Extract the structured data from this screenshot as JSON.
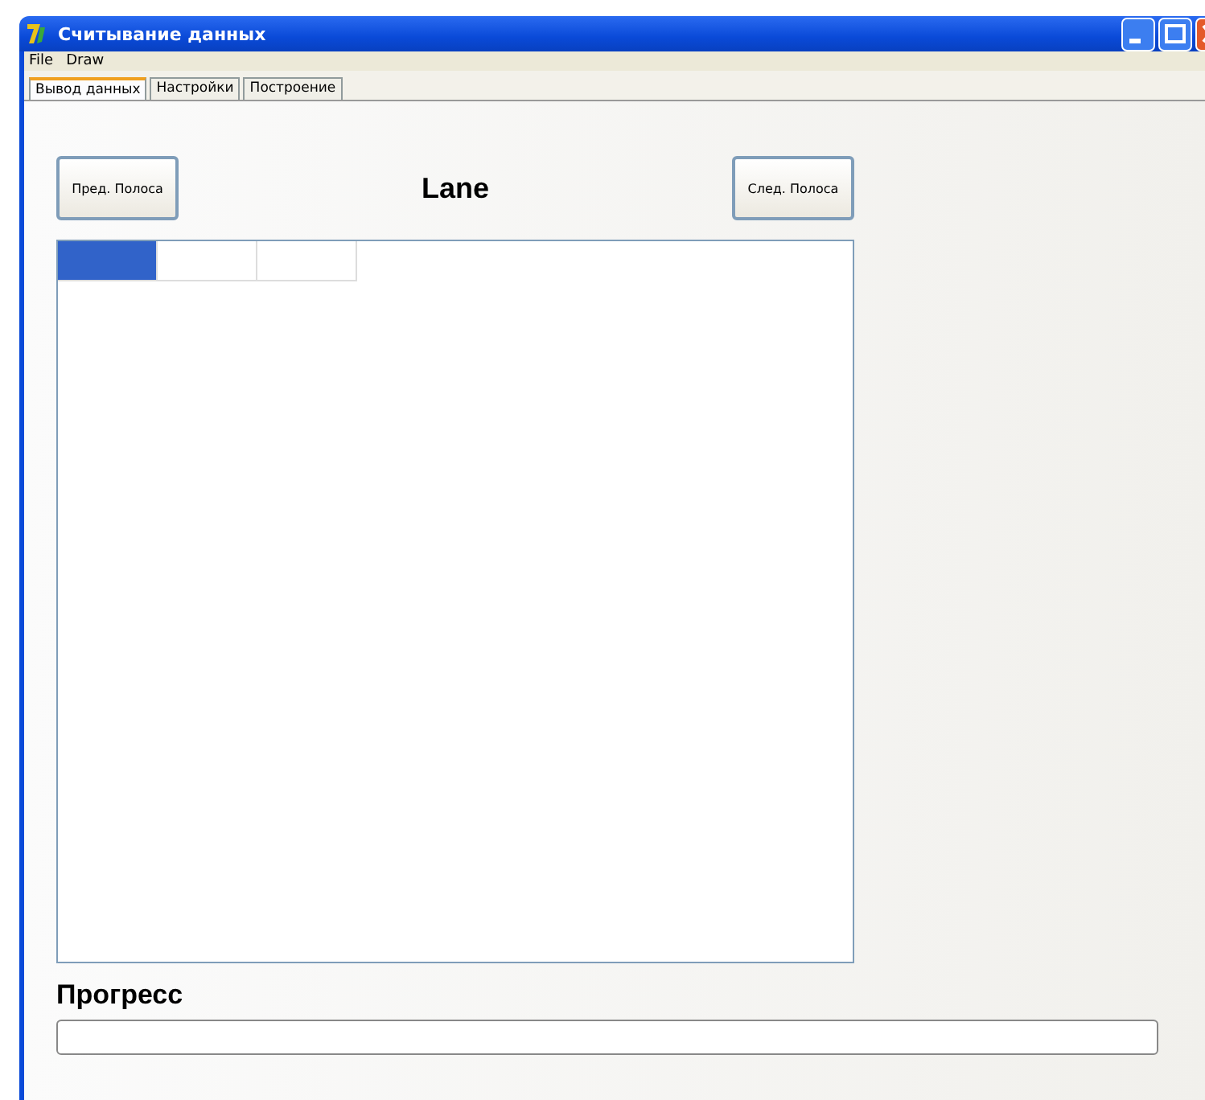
{
  "window": {
    "title": "Считывание данных"
  },
  "menu": [
    "File",
    "Draw"
  ],
  "tabs": [
    {
      "label": "Вывод данных",
      "selected": true
    },
    {
      "label": "Настройки",
      "selected": false
    },
    {
      "label": "Построение",
      "selected": false
    }
  ],
  "prev_button": "Пред. Полоса",
  "lane_title": "Lane",
  "next_button": "След. Полоса",
  "grid": {
    "cells": [
      {
        "selected": true
      },
      {
        "selected": false
      },
      {
        "selected": false
      }
    ]
  },
  "progress": {
    "label": "Прогресс",
    "level": 0
  }
}
